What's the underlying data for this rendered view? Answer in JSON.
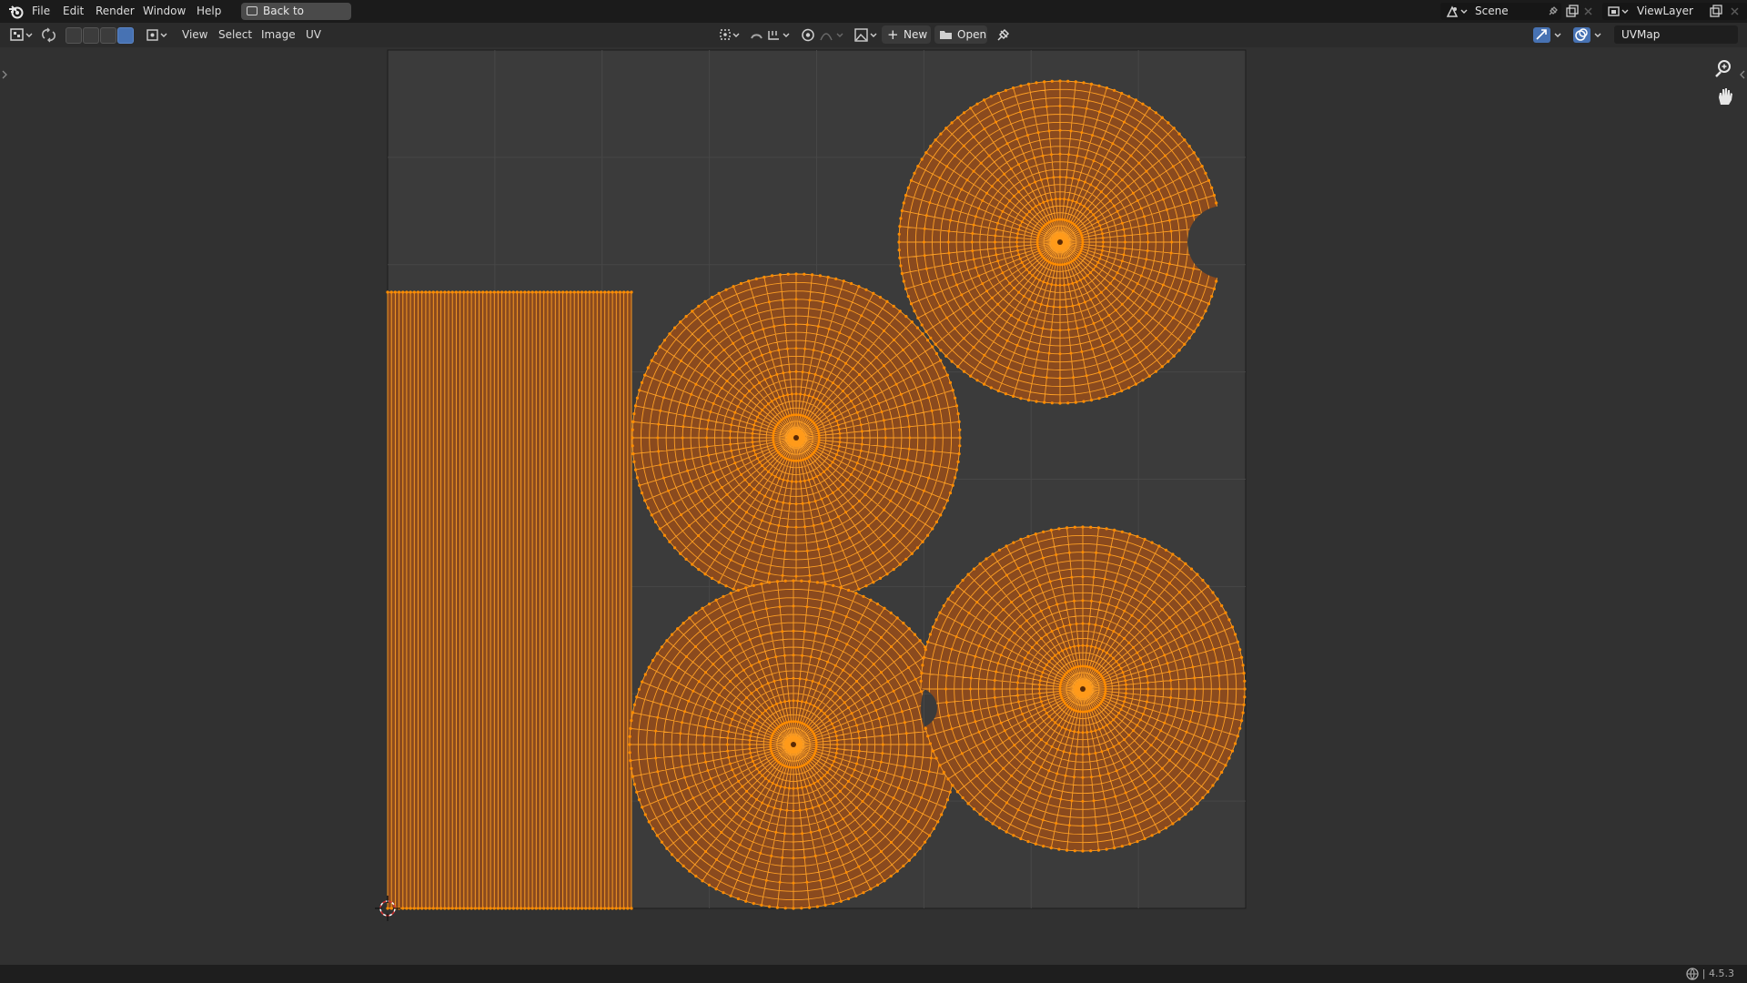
{
  "topbar": {
    "menus": [
      "File",
      "Edit",
      "Render",
      "Window",
      "Help"
    ],
    "back_button": "Back to Previous",
    "scene": "Scene",
    "view_layer": "ViewLayer"
  },
  "editor_header": {
    "menus": [
      "View",
      "Select",
      "Image",
      "UV"
    ],
    "new_button": "New",
    "open_button": "Open",
    "uv_map": "UVMap"
  },
  "status": {
    "version": "4.5.3"
  },
  "colors": {
    "uv_fill": "#8a4a1e",
    "uv_edge": "#ffa024",
    "uv_vertex": "#ff8c00",
    "canvas": "#3b3b3b",
    "grid": "#474747"
  },
  "icons": [
    "blender-logo-icon",
    "back-icon",
    "scene-icon",
    "pin-icon",
    "new-scene-icon",
    "close-icon",
    "view-layer-icon",
    "editor-type-icon",
    "sync-select-icon",
    "select-mode-icon",
    "pivot-icon",
    "snap-icon",
    "proportional-icon",
    "image-icon",
    "plus-icon",
    "folder-icon",
    "pin-image-icon",
    "gizmo-icon",
    "overlay-icon",
    "zoom-icon",
    "hand-icon",
    "cursor-icon",
    "globe-icon"
  ]
}
